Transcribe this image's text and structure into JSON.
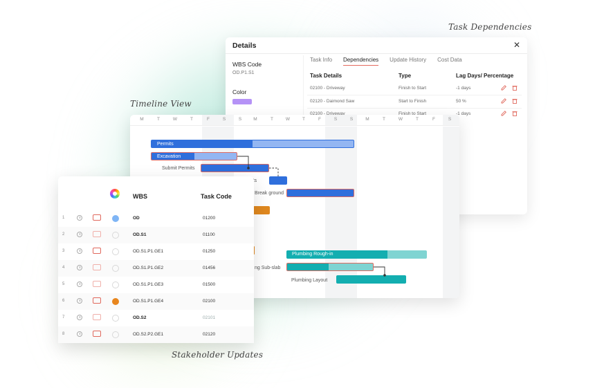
{
  "callouts": {
    "task_dependencies": "Task Dependencies",
    "timeline_view": "Timeline View",
    "stakeholder_updates": "Stakeholder Updates"
  },
  "details": {
    "title": "Details",
    "close_icon": "close-icon",
    "wbs_code_label": "WBS Code",
    "wbs_code_value": "OD.P1.S1",
    "color_label": "Color",
    "color_value": "#b592f6",
    "tabs": [
      "Task Info",
      "Dependencies",
      "Update History",
      "Cost Data"
    ],
    "active_tab": "Dependencies",
    "columns": [
      "Task Details",
      "Type",
      "Lag Days/ Percentage"
    ],
    "rows": [
      {
        "task": "02100 - Driveway",
        "type": "Finish to Start",
        "lag": "-1 days"
      },
      {
        "task": "02120 - Daimond Saw",
        "type": "Start to Finish",
        "lag": "50 %"
      },
      {
        "task": "02100 - Driveway",
        "type": "Finish to Start",
        "lag": "-1 days"
      }
    ]
  },
  "timeline": {
    "days": [
      "M",
      "T",
      "W",
      "T",
      "F",
      "S",
      "S",
      "M",
      "T",
      "W",
      "T",
      "F",
      "S",
      "S",
      "M",
      "T",
      "W",
      "T",
      "F",
      "S"
    ],
    "tasks": {
      "permits": "Permits",
      "excavation": "Excavation",
      "submit_permits": "Submit Permits",
      "permits_short": "rmits",
      "break_ground": "Break ground",
      "plumbing_rough_in": "Plumbing Rough-in",
      "sub_slab": "ng Sub-slab",
      "plumbing_layout": "Plumbing Layout"
    },
    "colors": {
      "blue": "#2f6fdc",
      "light_blue": "#93b6f2",
      "teal": "#13aeb0",
      "light_teal": "#7fd4d2",
      "orange": "#e0881f",
      "red_outline": "#e06a60"
    }
  },
  "wbs": {
    "columns": [
      "WBS",
      "Task Code"
    ],
    "rows": [
      {
        "n": "1",
        "wbs": "OD",
        "code": "01200",
        "bold": true,
        "dot": "#7fb5f5"
      },
      {
        "n": "2",
        "wbs": "OD.S1",
        "code": "01100",
        "bold": true,
        "dot": ""
      },
      {
        "n": "3",
        "wbs": "OD.S1.P1.GE1",
        "code": "01250",
        "bold": false,
        "dot": ""
      },
      {
        "n": "4",
        "wbs": "OD.S1.P1.GE2",
        "code": "01456",
        "bold": false,
        "dot": ""
      },
      {
        "n": "5",
        "wbs": "OD.S1.P1.GE3",
        "code": "01500",
        "bold": false,
        "dot": ""
      },
      {
        "n": "6",
        "wbs": "OD.S1.P1.GE4",
        "code": "02100",
        "bold": false,
        "dot": "#e8861e"
      },
      {
        "n": "7",
        "wbs": "OD.S2",
        "code": "02101",
        "bold": true,
        "dot": ""
      },
      {
        "n": "8",
        "wbs": "OD.S2.P2.GE1",
        "code": "02120",
        "bold": false,
        "dot": ""
      }
    ]
  }
}
